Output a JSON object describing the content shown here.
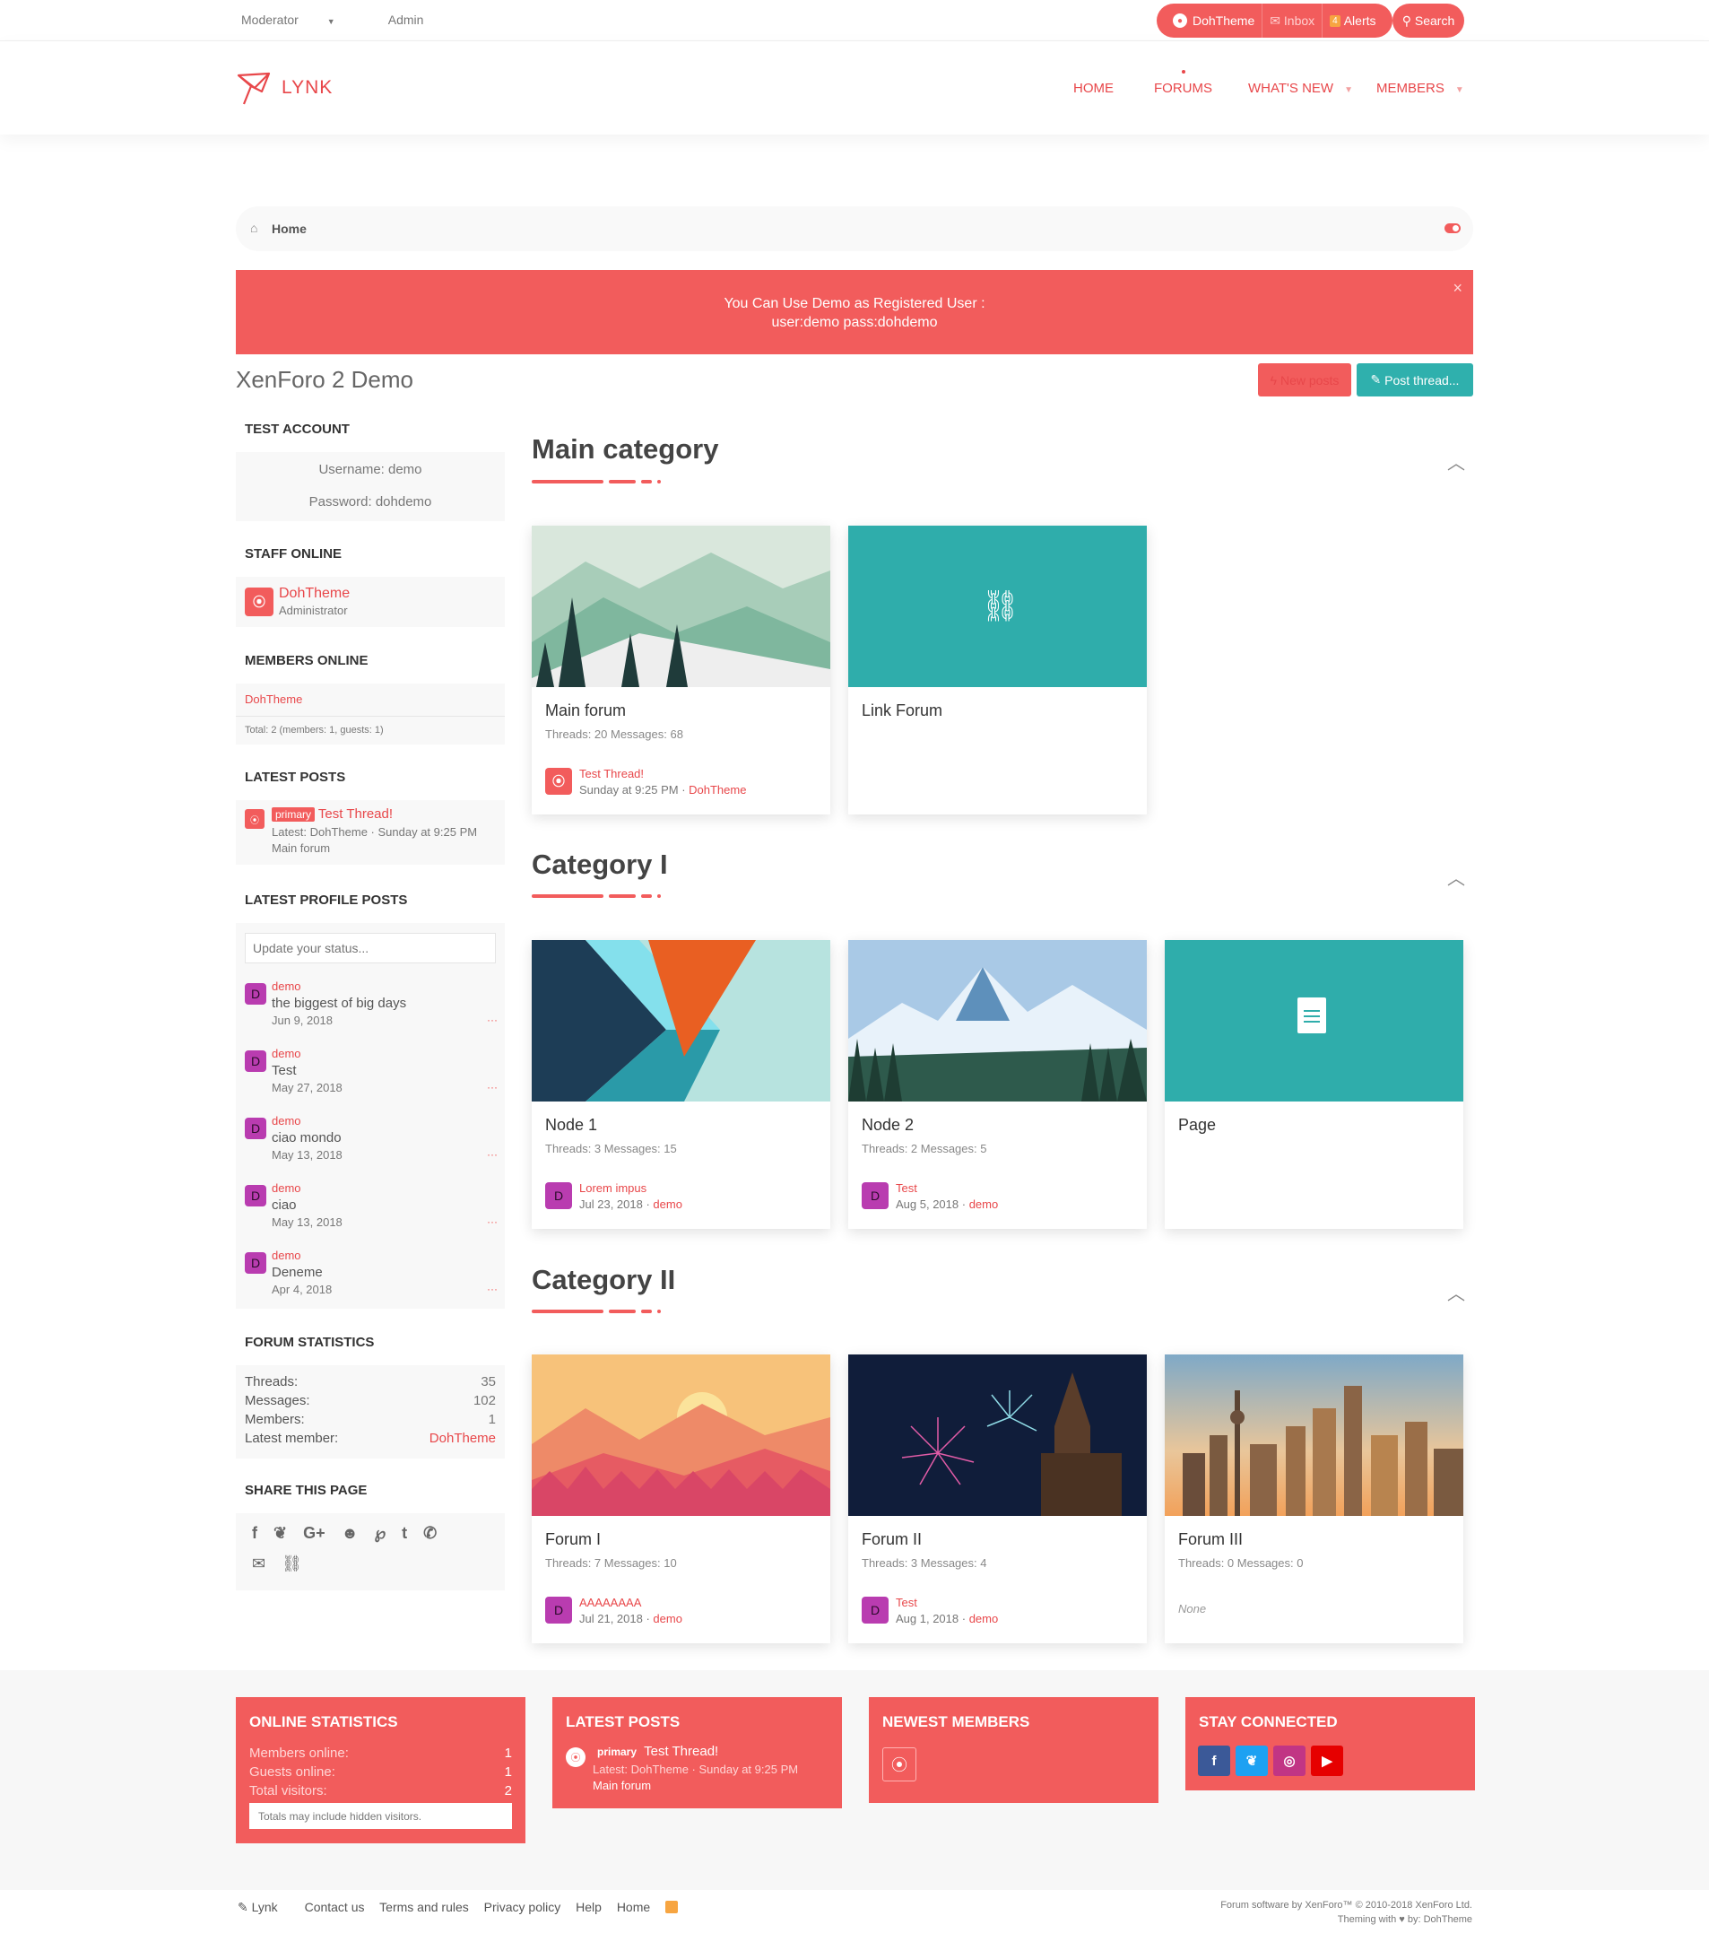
{
  "topbar": {
    "moderator": "Moderator",
    "admin": "Admin",
    "user": "DohTheme",
    "inbox": "Inbox",
    "alert_count": "4",
    "alerts": "Alerts",
    "search": "Search"
  },
  "header": {
    "logo": "LYNK",
    "nav": {
      "home": "HOME",
      "forums": "FORUMS",
      "whats_new": "WHAT'S NEW",
      "members": "MEMBERS"
    }
  },
  "breadcrumb": {
    "home": "Home"
  },
  "notice": {
    "line1": "You Can Use Demo as Registered User :",
    "line2": "user:demo pass:dohdemo",
    "close": "×"
  },
  "page": {
    "title": "XenForo 2 Demo",
    "new_posts": "New posts",
    "post_thread": "Post thread..."
  },
  "sidebar": {
    "test_account": {
      "title": "TEST ACCOUNT",
      "username": "Username: demo",
      "password": "Password: dohdemo"
    },
    "staff_online": {
      "title": "STAFF ONLINE",
      "name": "DohTheme",
      "role": "Administrator"
    },
    "members_online": {
      "title": "MEMBERS ONLINE",
      "member": "DohTheme",
      "total": "Total: 2 (members: 1, guests: 1)"
    },
    "latest_posts": {
      "title": "LATEST POSTS",
      "prefix": "primary",
      "thread": "Test Thread!",
      "latest": "Latest: DohTheme · Sunday at 9:25 PM",
      "forum": "Main forum"
    },
    "profile_posts": {
      "title": "LATEST PROFILE POSTS",
      "placeholder": "Update your status...",
      "items": [
        {
          "user": "demo",
          "text": "the biggest of big days",
          "date": "Jun 9, 2018"
        },
        {
          "user": "demo",
          "text": "Test",
          "date": "May 27, 2018"
        },
        {
          "user": "demo",
          "text": "ciao mondo",
          "date": "May 13, 2018"
        },
        {
          "user": "demo",
          "text": "ciao",
          "date": "May 13, 2018"
        },
        {
          "user": "demo",
          "text": "Deneme",
          "date": "Apr 4, 2018"
        }
      ],
      "more": "···"
    },
    "stats": {
      "title": "FORUM STATISTICS",
      "threads_label": "Threads:",
      "threads": "35",
      "messages_label": "Messages:",
      "messages": "102",
      "members_label": "Members:",
      "members": "1",
      "latest_label": "Latest member:",
      "latest": "DohTheme"
    },
    "share": {
      "title": "SHARE THIS PAGE"
    }
  },
  "categories": [
    {
      "title": "Main category",
      "nodes": [
        {
          "name": "Main forum",
          "meta": "Threads: 20 Messages: 68",
          "last_title": "Test Thread!",
          "last_date": "Sunday at 9:25 PM",
          "last_user": "DohTheme"
        },
        {
          "name": "Link Forum"
        }
      ]
    },
    {
      "title": "Category I",
      "nodes": [
        {
          "name": "Node 1",
          "meta": "Threads: 3 Messages: 15",
          "last_title": "Lorem impus",
          "last_date": "Jul 23, 2018",
          "last_user": "demo"
        },
        {
          "name": "Node 2",
          "meta": "Threads: 2 Messages: 5",
          "last_title": "Test",
          "last_date": "Aug 5, 2018",
          "last_user": "demo"
        },
        {
          "name": "Page"
        }
      ]
    },
    {
      "title": "Category II",
      "nodes": [
        {
          "name": "Forum I",
          "meta": "Threads: 7 Messages: 10",
          "last_title": "AAAAAAAA",
          "last_date": "Jul 21, 2018",
          "last_user": "demo"
        },
        {
          "name": "Forum II",
          "meta": "Threads: 3 Messages: 4",
          "last_title": "Test",
          "last_date": "Aug 1, 2018",
          "last_user": "demo"
        },
        {
          "name": "Forum III",
          "meta": "Threads: 0 Messages: 0",
          "none": "None"
        }
      ]
    }
  ],
  "footer_widgets": {
    "online": {
      "title": "ONLINE STATISTICS",
      "members_label": "Members online:",
      "members": "1",
      "guests_label": "Guests online:",
      "guests": "1",
      "total_label": "Total visitors:",
      "total": "2",
      "note": "Totals may include hidden visitors."
    },
    "latest": {
      "title": "LATEST POSTS",
      "prefix": "primary",
      "thread": "Test Thread!",
      "latest": "Latest: DohTheme · Sunday at 9:25 PM",
      "forum": "Main forum"
    },
    "newest": {
      "title": "NEWEST MEMBERS"
    },
    "stay": {
      "title": "STAY CONNECTED"
    }
  },
  "bottom": {
    "links": [
      "Lynk",
      "Contact us",
      "Terms and rules",
      "Privacy policy",
      "Help",
      "Home"
    ],
    "copyright1": "Forum software by XenForo™ © 2010-2018 XenForo Ltd.",
    "copyright2": "Theming with ♥ by: DohTheme"
  },
  "colors": {
    "accent": "#f25c5c",
    "teal": "#2fb0ad",
    "avatar_purple": "#b93cb0"
  }
}
